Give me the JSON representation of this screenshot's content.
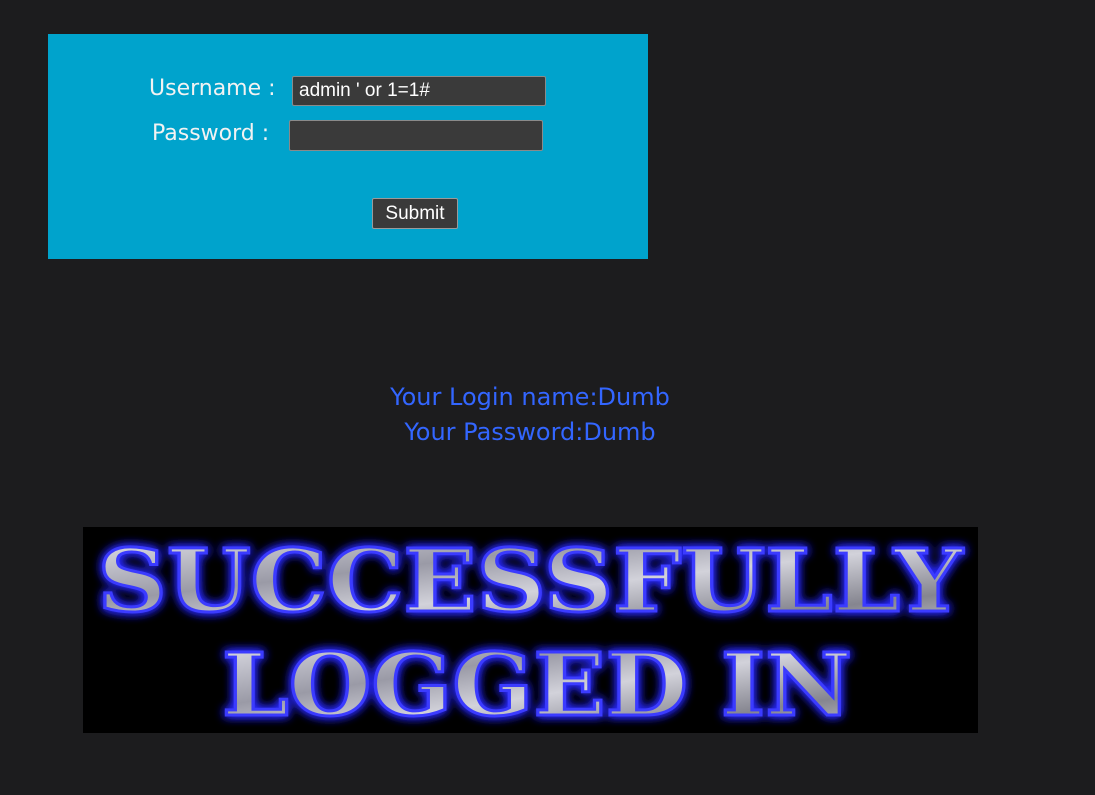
{
  "login_form": {
    "username_label": "Username :",
    "password_label": "Password :",
    "username_value": "admin ' or 1=1#",
    "password_value": "",
    "submit_label": "Submit"
  },
  "result": {
    "login_name_line": "Your Login name:Dumb",
    "password_line": "Your Password:Dumb"
  },
  "banner": {
    "line1": "SUCCESSFULLY",
    "line2": "LOGGED IN"
  },
  "colors": {
    "page_background": "#1c1c1e",
    "form_background": "#00a3cc",
    "result_text": "#3366ff",
    "banner_glow": "#2a2aff"
  }
}
